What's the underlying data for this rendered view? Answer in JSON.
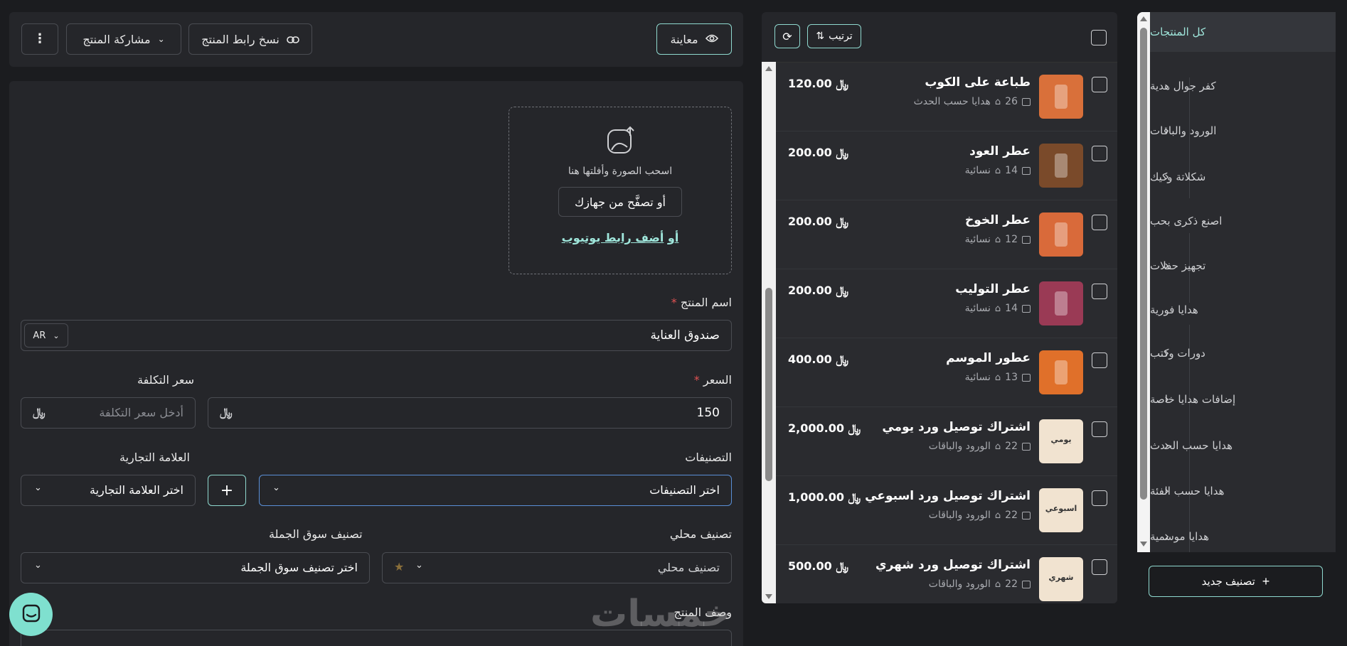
{
  "categories_panel": {
    "items": [
      {
        "label": "كل المنتجات",
        "has_children": false,
        "active": true
      },
      {
        "label": "كفر جوال هدية",
        "has_children": false
      },
      {
        "label": "الورود والباقات",
        "has_children": true
      },
      {
        "label": "شكلاتة وكيك",
        "has_children": true
      },
      {
        "label": "اصنع ذكرى بحب",
        "has_children": false
      },
      {
        "label": "تجهيز حفلات",
        "has_children": true
      },
      {
        "label": "هدايا فورية",
        "has_children": false
      },
      {
        "label": "دورات وكتب",
        "has_children": true
      },
      {
        "label": "إضافات هدايا خاصة",
        "has_children": true
      },
      {
        "label": "هدايا حسب الحدث",
        "has_children": true
      },
      {
        "label": "هدايا حسب الفئة",
        "has_children": true
      },
      {
        "label": "هدايا موسمية",
        "has_children": true
      }
    ],
    "new_category_label": "تصنيف جديد"
  },
  "products_panel": {
    "sort_label": "ترتيب",
    "currency_symbol": "﷼",
    "products": [
      {
        "name": "طباعة على الكوب",
        "price": "120.00",
        "count": "26",
        "category": "هدايا حسب الحدث",
        "thumb_color": "#d9703a"
      },
      {
        "name": "عطر العود",
        "price": "200.00",
        "count": "14",
        "category": "نسائية",
        "thumb_color": "#7a4a2a"
      },
      {
        "name": "عطر الخوخ",
        "price": "200.00",
        "count": "12",
        "category": "نسائية",
        "thumb_color": "#d96a3a"
      },
      {
        "name": "عطر التوليب",
        "price": "200.00",
        "count": "14",
        "category": "نسائية",
        "thumb_color": "#9a3a55"
      },
      {
        "name": "عطور الموسم",
        "price": "400.00",
        "count": "13",
        "category": "نسائية",
        "thumb_color": "#e0702a"
      },
      {
        "name": "اشتراك توصيل ورد يومي",
        "price": "2,000.00",
        "count": "22",
        "category": "الورود والباقات",
        "thumb_color": "#f1e3d0",
        "thumb_text": "يومي"
      },
      {
        "name": "اشتراك توصيل ورد اسبوعي",
        "price": "1,000.00",
        "count": "22",
        "category": "الورود والباقات",
        "thumb_color": "#f1e3d0",
        "thumb_text": "اسبوعي"
      },
      {
        "name": "اشتراك توصيل ورد شهري",
        "price": "500.00",
        "count": "22",
        "category": "الورود والباقات",
        "thumb_color": "#f1e3d0",
        "thumb_text": "شهري"
      }
    ]
  },
  "toolbar": {
    "preview_label": "معاينة",
    "copy_link_label": "نسخ رابط المنتج",
    "share_label": "مشاركة المنتج"
  },
  "upload": {
    "drag_text": "اسحب الصورة وأفلتها هنا",
    "browse_label": "أو تصفَّح من جهازك",
    "youtube_prefix": "أو",
    "youtube_link": "أضف رابط يوتيوب"
  },
  "form": {
    "name_label": "اسم المنتج",
    "name_value": "صندوق العناية",
    "lang": "AR",
    "price_label": "السعر",
    "price_value": "150",
    "cost_label": "سعر التكلفة",
    "cost_placeholder": "أدخل سعر التكلفة",
    "categories_label": "التصنيفات",
    "categories_placeholder": "اختر التصنيفات",
    "brand_label": "العلامة التجارية",
    "brand_placeholder": "اختر العلامة التجارية",
    "local_class_label": "تصنيف محلي",
    "local_class_placeholder": "تصنيف محلي",
    "wholesale_label": "تصنيف سوق الجملة",
    "wholesale_placeholder": "اختر تصنيف سوق الجملة",
    "description_label": "وصف المنتج"
  },
  "watermark": "خمسات"
}
